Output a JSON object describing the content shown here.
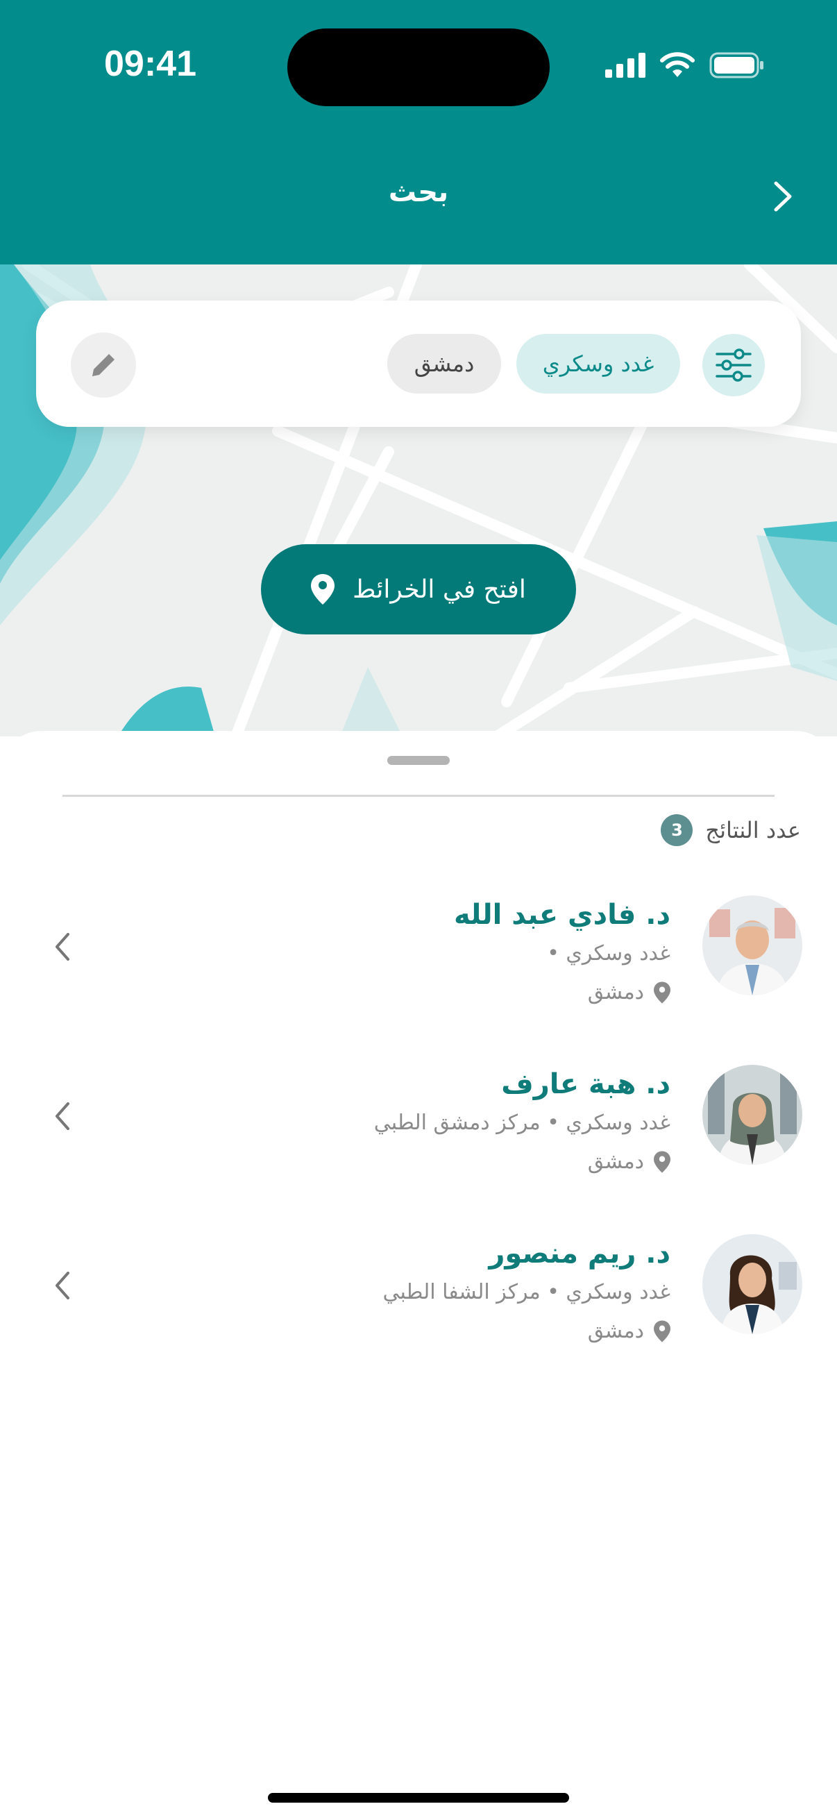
{
  "status_bar": {
    "time": "09:41"
  },
  "header": {
    "title": "بحث"
  },
  "search": {
    "chips": {
      "specialty": "غدد وسكري",
      "city": "دمشق"
    }
  },
  "map": {
    "open_button_label": "افتح في الخرائط"
  },
  "results": {
    "label": "عدد النتائج",
    "count": "3",
    "items": [
      {
        "name": "د. فادي عبد الله",
        "subtitle": "غدد وسكري •",
        "location": "دمشق"
      },
      {
        "name": "د. هبة عارف",
        "subtitle": "غدد وسكري • مركز دمشق الطبي",
        "location": "دمشق"
      },
      {
        "name": "د. ريم منصور",
        "subtitle": "غدد وسكري • مركز الشفا الطبي",
        "location": "دمشق"
      }
    ]
  },
  "colors": {
    "primary": "#028d8c",
    "accent_dark": "#037a78",
    "accent_light": "#d7efee"
  }
}
